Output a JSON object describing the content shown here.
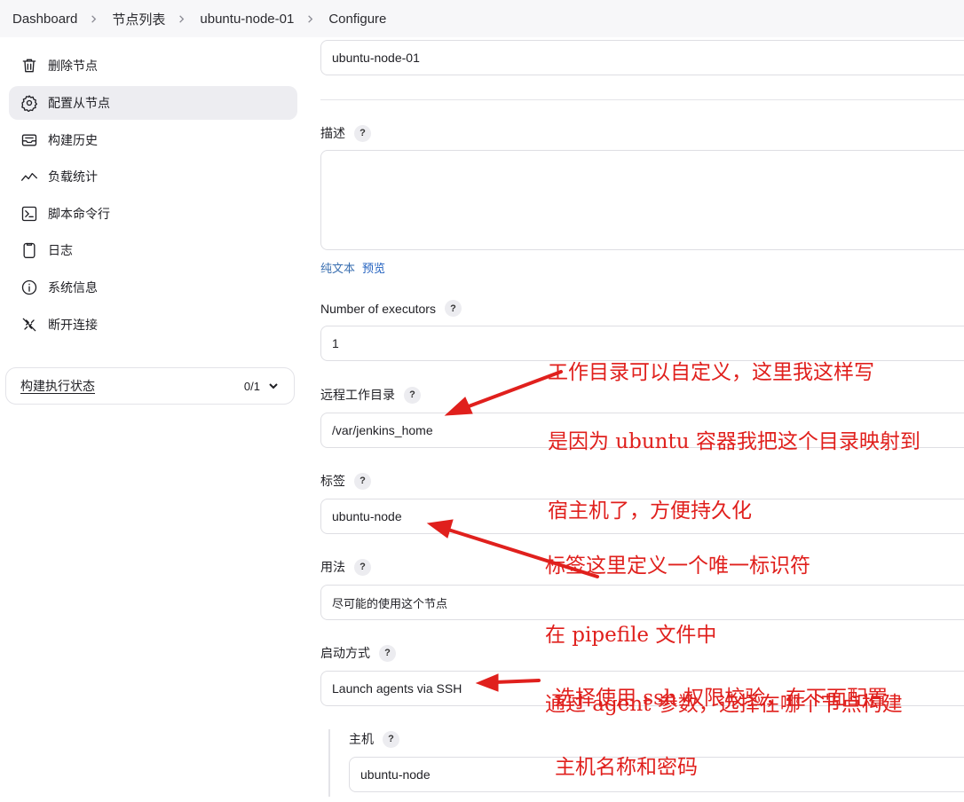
{
  "breadcrumb": [
    "Dashboard",
    "节点列表",
    "ubuntu-node-01",
    "Configure"
  ],
  "sidebar": {
    "items": [
      {
        "label": "删除节点",
        "icon": "trash-icon"
      },
      {
        "label": "配置从节点",
        "icon": "gear-icon",
        "active": true
      },
      {
        "label": "构建历史",
        "icon": "inbox-icon"
      },
      {
        "label": "负载统计",
        "icon": "chart-line-icon"
      },
      {
        "label": "脚本命令行",
        "icon": "terminal-icon"
      },
      {
        "label": "日志",
        "icon": "clipboard-icon"
      },
      {
        "label": "系统信息",
        "icon": "info-icon"
      },
      {
        "label": "断开连接",
        "icon": "disconnect-icon"
      }
    ],
    "executor_status": {
      "title": "构建执行状态",
      "count": "0/1"
    }
  },
  "form": {
    "name_value": "ubuntu-node-01",
    "description_label": "描述",
    "text_mode_plain": "纯文本",
    "text_mode_preview": "预览",
    "executors_label": "Number of executors",
    "executors_value": "1",
    "remote_dir_label": "远程工作目录",
    "remote_dir_value": "/var/jenkins_home",
    "labels_label": "标签",
    "labels_value": "ubuntu-node",
    "usage_label": "用法",
    "usage_value": "尽可能的使用这个节点",
    "launch_label": "启动方式",
    "launch_value": "Launch agents via SSH",
    "host_label": "主机",
    "host_value": "ubuntu-node",
    "help_glyph": "?"
  },
  "annotations": {
    "workdir": [
      "工作目录可以自定义，这里我这样写",
      "是因为 ubuntu 容器我把这个目录映射到",
      "宿主机了，方便持久化"
    ],
    "label": [
      "标签这里定义一个唯一标识符",
      "在 pipefile 文件中",
      "通过 agent 参数，选择在哪个节点构建"
    ],
    "launch": [
      "选择使用 ssh 权限校验，在下面配置",
      "主机名称和密码"
    ],
    "color": "#e0201d"
  },
  "colors": {
    "accent_link": "#1f5fbf",
    "active_bg": "#ededf1",
    "annotation": "#e0201d"
  }
}
